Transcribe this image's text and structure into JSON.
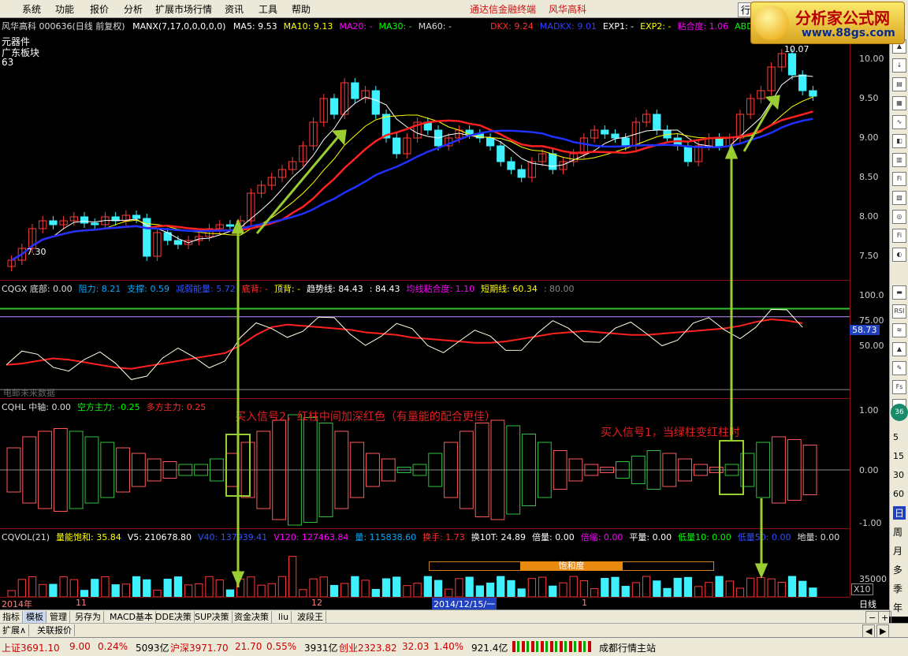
{
  "menu": {
    "items": [
      "系统",
      "功能",
      "报价",
      "分析",
      "扩展市场行情",
      "资讯",
      "工具",
      "帮助"
    ],
    "promo": [
      "通达信金融终端",
      "风华高科"
    ],
    "trade_btn": "行"
  },
  "logo": {
    "title": "分析家公式网",
    "url": "www.88gs.com"
  },
  "main": {
    "title_line": "风华高科 000636(日线 前复权)",
    "manx": "MANX(7,17,0,0,0,0,0)",
    "ma": [
      {
        "label": "MA5: 9.53",
        "color": "#ffffff"
      },
      {
        "label": "MA10: 9.13",
        "color": "#ffff00"
      },
      {
        "label": "MA20: -",
        "color": "#ff00ff"
      },
      {
        "label": "MA30: -",
        "color": "#00ff00"
      },
      {
        "label": "MA60: -",
        "color": "#dddddd"
      }
    ],
    "right_info": [
      {
        "label": "DKX: 9.24",
        "color": "#ff3030"
      },
      {
        "label": "MADKX: 9.01",
        "color": "#3040ff"
      },
      {
        "label": "EXP1: -",
        "color": "#ffffff"
      },
      {
        "label": "EXP2: -",
        "color": "#ffff00"
      },
      {
        "label": "粘合度: 1.06",
        "color": "#ff00ff"
      },
      {
        "label": "ABD: 1",
        "color": "#00ff00"
      }
    ],
    "sector1": "元器件",
    "sector2": "广东板块",
    "count": "63",
    "high_label": "10.07",
    "low_label": "7.30",
    "y_ticks": [
      "10.00",
      "9.50",
      "9.00",
      "8.50",
      "8.00",
      "7.50"
    ]
  },
  "cqgx": {
    "items": [
      {
        "label": "CQGX 底部: 0.00",
        "color": "#dddddd"
      },
      {
        "label": "阻力: 8.21",
        "color": "#00aaff"
      },
      {
        "label": "支撑: 0.59",
        "color": "#00aaff"
      },
      {
        "label": "减弱能量: 5.72",
        "color": "#3050ff"
      },
      {
        "label": "底背: -",
        "color": "#ff3030"
      },
      {
        "label": "顶背: -",
        "color": "#ffff00"
      },
      {
        "label": "趋势线: 84.43",
        "color": "#ffffff"
      },
      {
        "label": ": 84.43",
        "color": "#ffffff"
      },
      {
        "label": "均线粘合度: 1.10",
        "color": "#ff00ff"
      },
      {
        "label": "短期线: 60.34",
        "color": "#ffff00"
      },
      {
        "label": ": 80.00",
        "color": "#888888"
      }
    ],
    "y_ticks": [
      "100.0",
      "75.00",
      "50.00"
    ],
    "current": "58.73",
    "footer": "电邮未来数据"
  },
  "cqhl": {
    "items": [
      {
        "label": "CQHL 中轴: 0.00",
        "color": "#dddddd"
      },
      {
        "label": "空方主力: -0.25",
        "color": "#00ff00"
      },
      {
        "label": "多方主力: 0.25",
        "color": "#ff3030"
      }
    ],
    "y_ticks": [
      "1.00",
      "0.00",
      "-1.00"
    ]
  },
  "cqvol": {
    "items": [
      {
        "label": "CQVOL(21)",
        "color": "#dddddd"
      },
      {
        "label": "量能饱和: 35.84",
        "color": "#ffff00"
      },
      {
        "label": "V5: 210678.80",
        "color": "#ffffff"
      },
      {
        "label": "V40: 137939.41",
        "color": "#3050ff"
      },
      {
        "label": "V120: 127463.84",
        "color": "#ff00ff"
      },
      {
        "label": "量: 115838.60",
        "color": "#00aaff"
      },
      {
        "label": "换手: 1.73",
        "color": "#ff3030"
      },
      {
        "label": "换10T: 24.89",
        "color": "#ffffff"
      },
      {
        "label": "倍量: 0.00",
        "color": "#ffffff"
      },
      {
        "label": "倍缩: 0.00",
        "color": "#ff00ff"
      },
      {
        "label": "平量: 0.00",
        "color": "#ffffff"
      },
      {
        "label": "低量10: 0.00",
        "color": "#00ff00"
      },
      {
        "label": "低量50: 0.00",
        "color": "#3050ff"
      },
      {
        "label": "地量: 0.00",
        "color": "#dddddd"
      }
    ],
    "saturation": "饱和度",
    "y_ticks": [
      "35000"
    ],
    "unit": "X10"
  },
  "time_axis": {
    "labels": [
      "2014年",
      "11",
      "12",
      "2014/12/15/一",
      "1"
    ],
    "period": "日线"
  },
  "annotations": {
    "buy2": "买入信号2，红柱中间加深红色（有量能的配合更佳）",
    "buy1": "买入信号1，当绿柱变红柱时"
  },
  "tabs": [
    "指标",
    "模板",
    "管理",
    "另存为",
    "MACD基本",
    "DDE决策",
    "SUP决策",
    "资金决策",
    "liu",
    "波段王"
  ],
  "subtabs": [
    "扩展∧",
    "关联报价"
  ],
  "sidebar_nums": [
    "5",
    "15",
    "30",
    "60"
  ],
  "sidebar_words": [
    "日",
    "周",
    "月",
    "多",
    "季",
    "年"
  ],
  "sidebar_badge": "36",
  "status": {
    "sh": "上证3691.10",
    "sh_chg": "9.00",
    "sh_pct": "0.24%",
    "sh_amt": "5093亿",
    "sz": "沪深3971.70",
    "sz_chg": "21.70",
    "sz_pct": "0.55%",
    "sz_amt": "3931亿",
    "cy": "创业2323.82",
    "cy_chg": "32.03",
    "cy_pct": "1.40%",
    "cy_amt": "921.4亿",
    "site": "成都行情主站"
  },
  "chart_data": {
    "type": "candlestick",
    "title": "风华高科 000636(日线 前复权)",
    "close": [
      7.45,
      7.6,
      7.85,
      7.95,
      7.9,
      7.95,
      8.0,
      7.92,
      7.9,
      8.0,
      7.95,
      8.02,
      7.98,
      7.5,
      7.8,
      7.7,
      7.65,
      7.7,
      7.75,
      7.85,
      7.9,
      7.88,
      7.95,
      8.3,
      8.4,
      8.5,
      8.6,
      8.7,
      8.9,
      9.2,
      9.5,
      9.3,
      9.7,
      9.5,
      9.6,
      9.3,
      9.0,
      8.8,
      9.0,
      9.2,
      9.1,
      8.9,
      9.0,
      9.1,
      9.05,
      9.0,
      8.9,
      8.7,
      8.6,
      8.5,
      8.7,
      8.8,
      8.6,
      8.7,
      8.8,
      9.0,
      9.1,
      9.05,
      9.0,
      8.9,
      9.2,
      9.3,
      9.1,
      9.0,
      8.9,
      8.7,
      8.9,
      9.0,
      8.9,
      9.0,
      9.3,
      9.5,
      9.6,
      9.9,
      10.07,
      9.8,
      9.6,
      9.53
    ],
    "ylim": [
      7.2,
      10.2
    ],
    "y_ticks": [
      10.0,
      9.5,
      9.0,
      8.5,
      8.0,
      7.5
    ],
    "cqgx_trend": [
      55,
      56,
      58,
      60,
      59,
      57,
      55,
      53,
      52,
      54,
      56,
      58,
      60,
      62,
      64,
      70,
      78,
      84,
      86,
      85,
      84,
      83,
      82,
      80,
      79,
      78,
      76,
      75,
      74,
      73,
      72,
      72,
      73,
      75,
      77,
      79,
      80,
      81,
      80,
      79,
      78,
      78,
      79,
      80,
      81,
      82,
      83,
      85,
      88,
      90,
      89,
      87
    ],
    "cqhl_bars": [
      0.4,
      0.6,
      0.7,
      0.75,
      0.7,
      0.6,
      0.5,
      0.4,
      0.3,
      0.2,
      0.15,
      0.1,
      -0.1,
      -0.2,
      0.3,
      0.5,
      0.7,
      0.9,
      1.0,
      0.95,
      0.85,
      0.7,
      0.5,
      0.3,
      0.2,
      -0.05,
      0.1,
      0.3,
      0.5,
      0.7,
      0.85,
      0.9,
      0.8,
      0.65,
      0.5,
      0.35,
      0.2,
      0.1,
      0.05,
      0.15,
      0.25,
      0.35,
      0.3,
      0.2,
      0.1,
      0.05,
      0.1,
      0.3,
      0.5,
      0.6,
      0.55,
      0.45
    ]
  }
}
